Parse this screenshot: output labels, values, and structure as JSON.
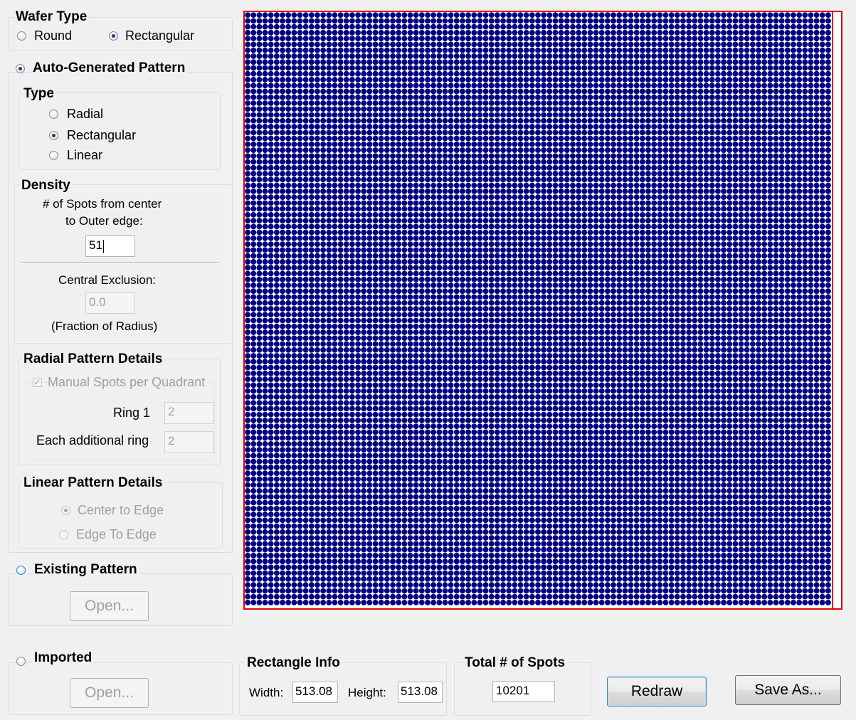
{
  "wafer_type": {
    "title": "Wafer Type",
    "options": [
      {
        "label": "Round",
        "selected": false
      },
      {
        "label": "Rectangular",
        "selected": true
      }
    ]
  },
  "auto_pattern": {
    "label": "Auto-Generated Pattern",
    "selected": true,
    "type": {
      "title": "Type",
      "options": [
        {
          "label": "Radial",
          "selected": false
        },
        {
          "label": "Rectangular",
          "selected": true
        },
        {
          "label": "Linear",
          "selected": false
        }
      ]
    },
    "density": {
      "title": "Density",
      "spots_label_line1": "# of Spots from center",
      "spots_label_line2": "to Outer edge:",
      "spots_value": "51",
      "exclusion_label": "Central Exclusion:",
      "exclusion_value": "0.0",
      "exclusion_note": "(Fraction of Radius)"
    },
    "radial_details": {
      "title": "Radial Pattern Details",
      "manual_label": "Manual Spots per Quadrant",
      "manual_checked": true,
      "ring1_label": "Ring 1",
      "ring1_value": "2",
      "additional_label": "Each additional ring",
      "additional_value": "2"
    },
    "linear_details": {
      "title": "Linear Pattern Details",
      "options": [
        {
          "label": "Center to Edge",
          "selected": true
        },
        {
          "label": "Edge To Edge",
          "selected": false
        }
      ]
    }
  },
  "existing_pattern": {
    "label": "Existing Pattern",
    "selected": false,
    "open_label": "Open..."
  },
  "imported": {
    "label": "Imported",
    "selected": false,
    "open_label": "Open..."
  },
  "rectangle_info": {
    "title": "Rectangle Info",
    "width_label": "Width:",
    "width_value": "513.08",
    "height_label": "Height:",
    "height_value": "513.08"
  },
  "total_spots": {
    "title": "Total # of Spots",
    "value": "10201"
  },
  "buttons": {
    "redraw": "Redraw",
    "save_as": "Save As..."
  },
  "spot_grid": {
    "columns": 101,
    "rows": 101,
    "spot_color": "#000080",
    "frame_color": "#e00000"
  }
}
